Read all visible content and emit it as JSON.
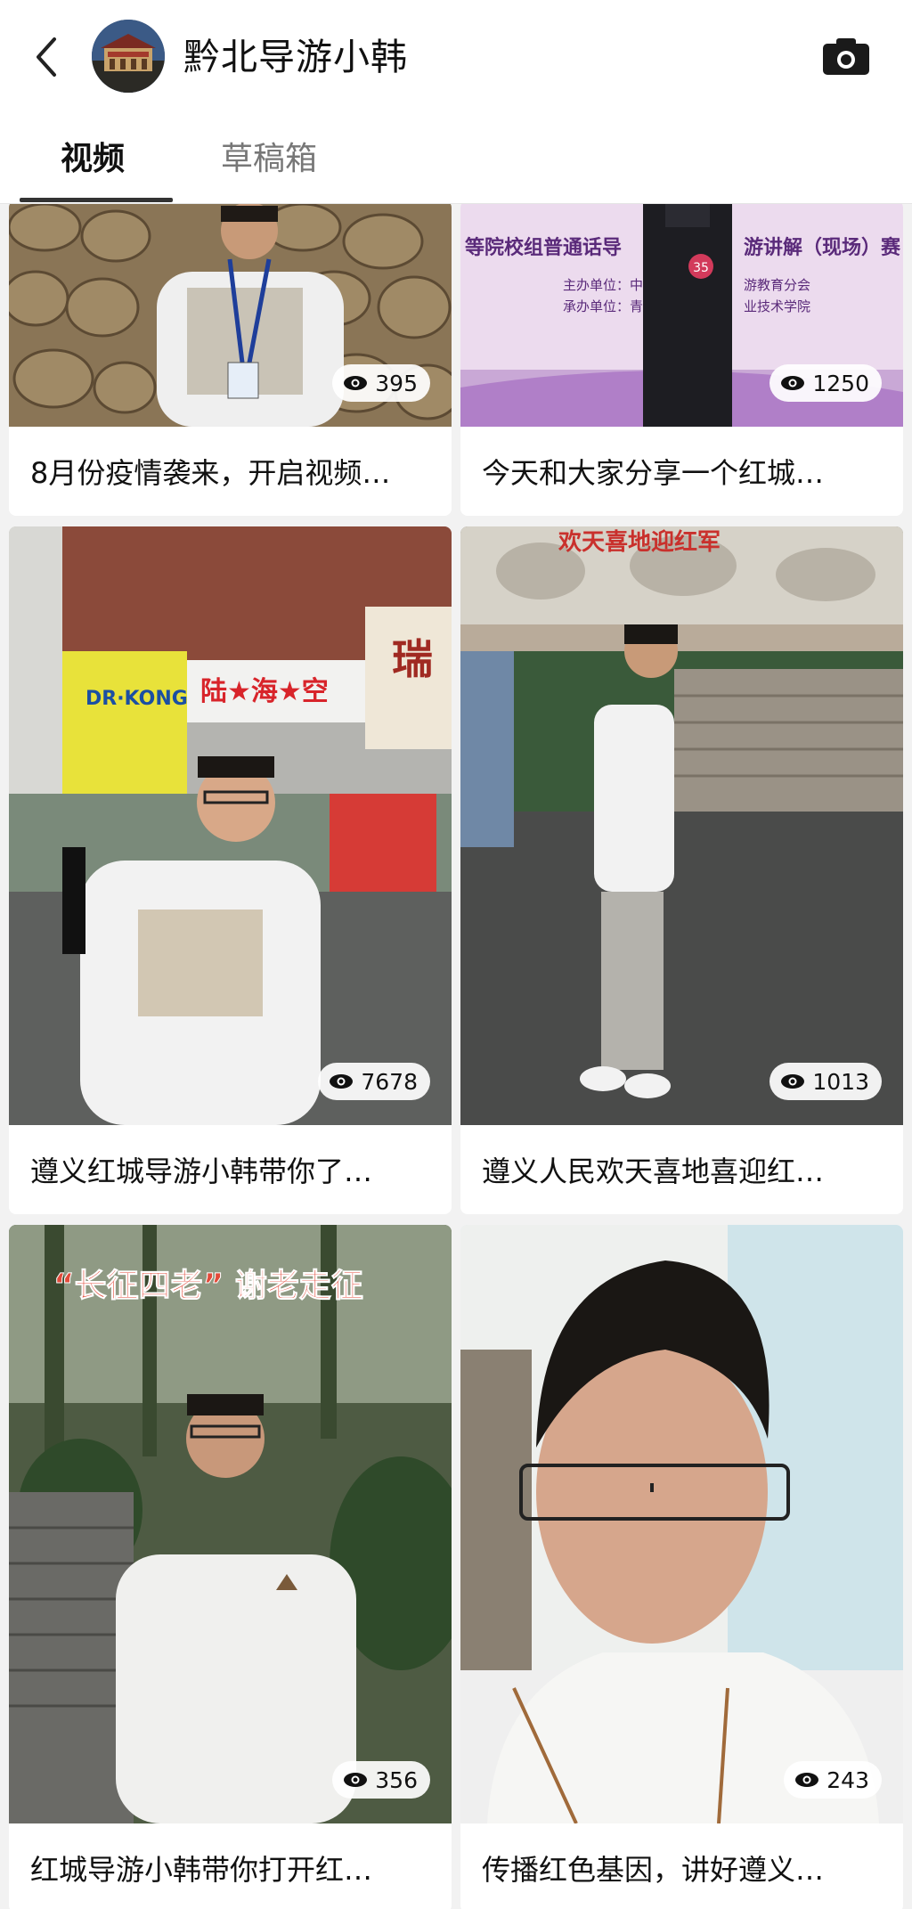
{
  "header": {
    "back_icon": "chevron-left-icon",
    "title": "黔北导游小韩",
    "camera_icon": "camera-icon"
  },
  "tabs": [
    {
      "label": "视频",
      "active": true
    },
    {
      "label": "草稿箱",
      "active": false
    }
  ],
  "videos": [
    {
      "caption": "8月份疫情袭来，开启视频…",
      "views": "395"
    },
    {
      "caption": "今天和大家分享一个红城…",
      "views": "1250",
      "banner_lines": [
        "等院校组普通话导",
        "游讲解（现场）赛",
        "主办单位：中",
        "游教育分会",
        "承办单位：青",
        "业技术学院"
      ],
      "badge": "35"
    },
    {
      "caption": "遵义红城导游小韩带你了…",
      "views": "7678",
      "signs": [
        "DR·KONG",
        "陆★海★空",
        "瑞"
      ]
    },
    {
      "caption": "遵义人民欢天喜地喜迎红…",
      "views": "1013",
      "signs": [
        "欢天喜地迎红军"
      ]
    },
    {
      "caption": "红城导游小韩带你打开红…",
      "views": "356",
      "signs": [
        "“长征四老” 谢老走征"
      ]
    },
    {
      "caption": "传播红色基因，讲好遵义…",
      "views": "243"
    }
  ],
  "colors": {
    "background": "#f2f2f2",
    "card": "#ffffff",
    "tab_underline": "#333333"
  }
}
